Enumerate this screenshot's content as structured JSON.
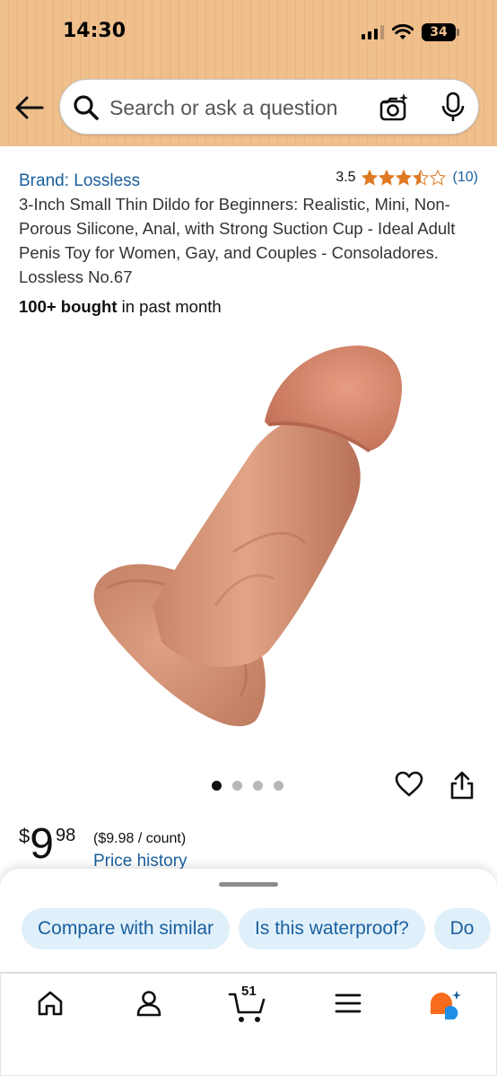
{
  "status_bar": {
    "time": "14:30",
    "battery": "34"
  },
  "search": {
    "placeholder": "Search or ask a question"
  },
  "product": {
    "brand": "Brand: Lossless",
    "rating": "3.5",
    "rating_count": "(10)",
    "title": "3-Inch Small Thin Dildo for Beginners: Realistic, Mini, Non-Porous Silicone, Anal, with Strong Suction Cup - Ideal Adult Penis Toy for Women, Gay, and Couples - Consoladores. Lossless No.67",
    "bought_bold": "100+ bought",
    "bought_rest": " in past month",
    "image_count": 4,
    "image_active_index": 0
  },
  "price": {
    "symbol": "$",
    "whole": "9",
    "fraction": "98",
    "unit": "($9.98 / count)",
    "history_link": "Price history"
  },
  "suggestions": [
    "Compare with similar",
    "Is this waterproof?",
    "Do"
  ],
  "bottom_nav": {
    "items": [
      "home-icon",
      "account-icon",
      "cart-icon",
      "menu-icon",
      "rufus-icon"
    ],
    "cart_count": "51"
  },
  "colors": {
    "header_bg": "#efbf8c",
    "link": "#1a5f9e",
    "star": "#de7921",
    "chip_bg": "#e0f0fb"
  }
}
